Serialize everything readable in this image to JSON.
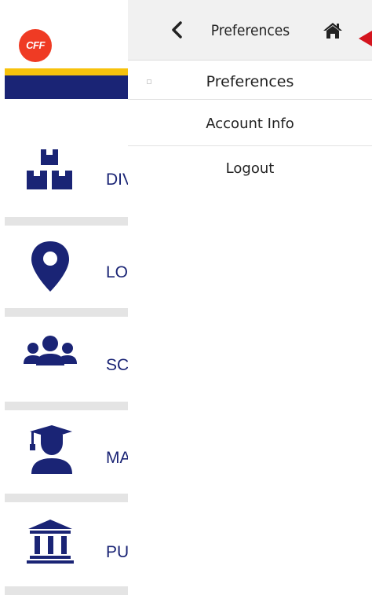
{
  "background_app": {
    "logo_text": "CFF",
    "menu": [
      {
        "label": "DIVISIONS",
        "icon": "boxes-icon"
      },
      {
        "label": "LOCATIONS",
        "icon": "map-pin-icon"
      },
      {
        "label": "SCHOOLS",
        "icon": "users-icon"
      },
      {
        "label": "MANAGEMENT",
        "icon": "graduate-icon"
      },
      {
        "label": "PUBLIC",
        "icon": "bank-icon"
      }
    ]
  },
  "panel": {
    "title": "Preferences",
    "items": [
      {
        "label": "Preferences"
      },
      {
        "label": "Account Info"
      },
      {
        "label": "Logout"
      }
    ]
  },
  "colors": {
    "navy": "#1a2475",
    "yellow": "#f7c20c",
    "logo_red": "#ef3b24",
    "pointer_red": "#d4141e"
  }
}
